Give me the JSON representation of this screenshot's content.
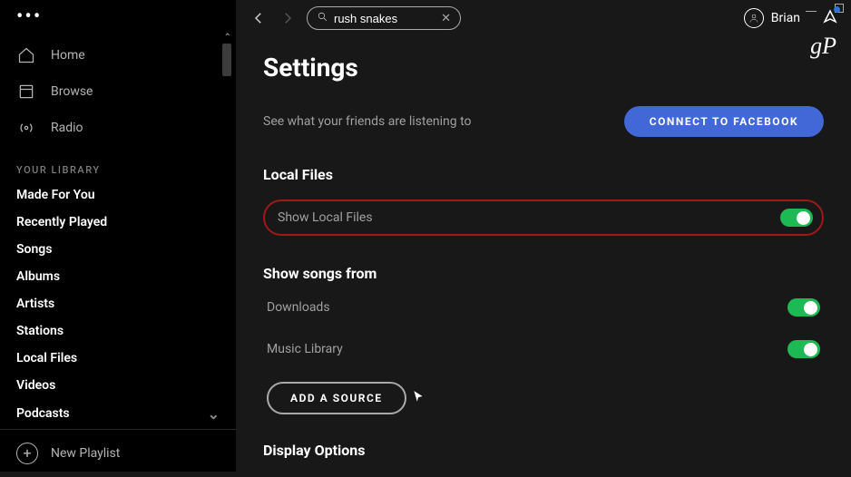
{
  "topbar": {
    "search_value": "rush snakes",
    "user_name": "Brian"
  },
  "branding": {
    "logo_text": "gP"
  },
  "sidebar": {
    "nav": [
      {
        "label": "Home",
        "icon": "home-icon"
      },
      {
        "label": "Browse",
        "icon": "browse-icon"
      },
      {
        "label": "Radio",
        "icon": "radio-icon"
      }
    ],
    "library_header": "YOUR LIBRARY",
    "library_items": [
      "Made For You",
      "Recently Played",
      "Songs",
      "Albums",
      "Artists",
      "Stations",
      "Local Files",
      "Videos",
      "Podcasts"
    ],
    "new_playlist_label": "New Playlist"
  },
  "settings": {
    "page_title": "Settings",
    "friends_text": "See what your friends are listening to",
    "facebook_button": "CONNECT TO FACEBOOK",
    "local_files_header": "Local Files",
    "show_local_files_label": "Show Local Files",
    "show_songs_from_header": "Show songs from",
    "sources": [
      {
        "label": "Downloads"
      },
      {
        "label": "Music Library"
      }
    ],
    "add_source_button": "ADD A SOURCE",
    "display_options_header": "Display Options"
  }
}
